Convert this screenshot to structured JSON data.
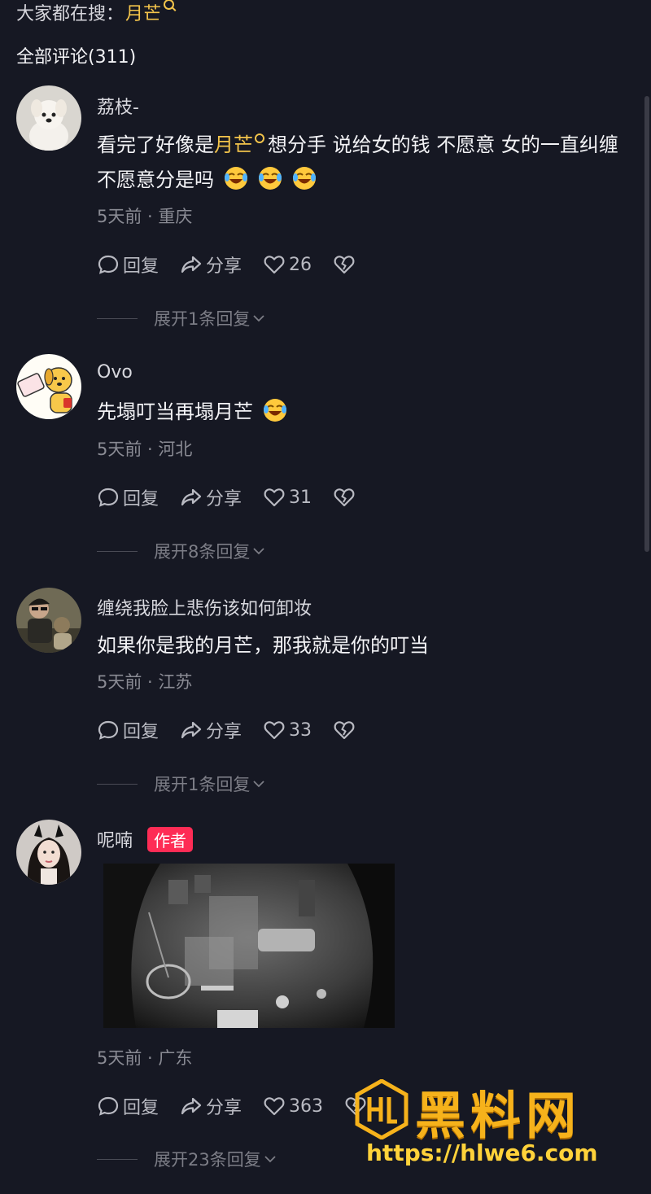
{
  "header": {
    "search_prefix": "大家都在搜：",
    "search_keyword": "月芒",
    "comment_count": "全部评论(311)"
  },
  "comments": [
    {
      "username": "荔枝-",
      "text_before": "看完了好像是",
      "keyword": "月芒",
      "text_after": "想分手 说给女的钱 不愿意 女的一直纠缠不愿意分是吗",
      "emojis": [
        "laugh-cry-emoji",
        "laugh-cry-emoji",
        "laugh-cry-emoji"
      ],
      "meta": "5天前 · 重庆",
      "reply": "回复",
      "share": "分享",
      "likes": "26",
      "expand": "展开1条回复"
    },
    {
      "username": "Ovo",
      "text": "先塌叮当再塌月芒",
      "emojis": [
        "laugh-cry-emoji"
      ],
      "meta": "5天前 · 河北",
      "reply": "回复",
      "share": "分享",
      "likes": "31",
      "expand": "展开8条回复"
    },
    {
      "username": "缠绕我脸上悲伤该如何卸妆",
      "text": "如果你是我的月芒，那我就是你的叮当",
      "meta": "5天前 · 江苏",
      "reply": "回复",
      "share": "分享",
      "likes": "33",
      "expand": "展开1条回复"
    },
    {
      "username": "呢喃",
      "badge": "作者",
      "meta": "5天前 · 广东",
      "reply": "回复",
      "share": "分享",
      "likes": "363",
      "expand": "展开23条回复"
    }
  ],
  "watermark": {
    "title": "黑料网",
    "url": "https://hlwe6.com"
  },
  "colors": {
    "background": "#161823",
    "keyword": "#f3c44b",
    "author_badge": "#fe2c55",
    "watermark": "#f6b21b"
  }
}
